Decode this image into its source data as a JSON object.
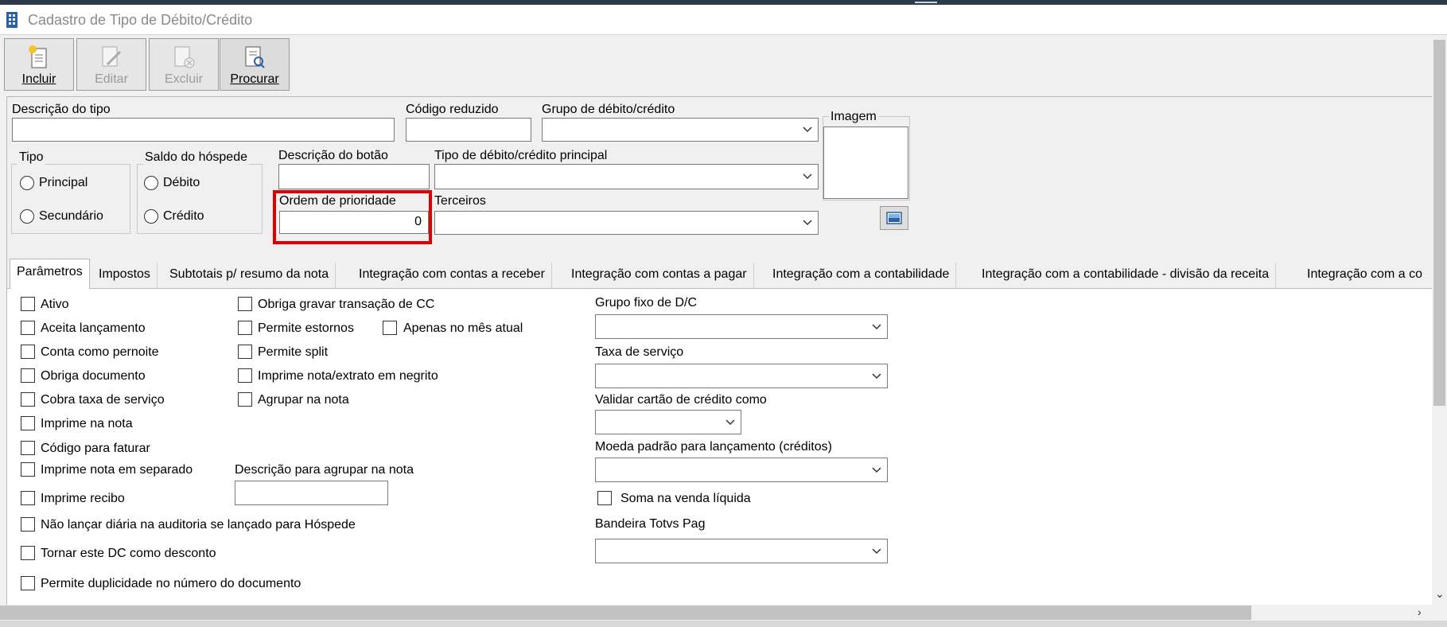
{
  "window": {
    "title": "Cadastro de Tipo de Débito/Crédito"
  },
  "toolbar": {
    "buttons": [
      {
        "id": "incluir",
        "label": "Incluir",
        "enabled": true
      },
      {
        "id": "editar",
        "label": "Editar",
        "enabled": false
      },
      {
        "id": "excluir",
        "label": "Excluir",
        "enabled": false
      },
      {
        "id": "procurar",
        "label": "Procurar",
        "enabled": true
      }
    ]
  },
  "form": {
    "descricao_tipo": {
      "label": "Descrição do tipo",
      "value": ""
    },
    "codigo_reduzido": {
      "label": "Código reduzido",
      "value": ""
    },
    "grupo_debito_credito": {
      "label": "Grupo de débito/crédito",
      "value": ""
    },
    "imagem": {
      "label": "Imagem"
    },
    "tipo": {
      "label": "Tipo",
      "options": [
        "Principal",
        "Secundário"
      ],
      "selected": null
    },
    "saldo_hospede": {
      "label": "Saldo do hóspede",
      "options": [
        "Débito",
        "Crédito"
      ],
      "selected": null
    },
    "descricao_botao": {
      "label": "Descrição do botão",
      "value": ""
    },
    "tipo_principal": {
      "label": "Tipo de débito/crédito principal",
      "value": ""
    },
    "ordem_prioridade": {
      "label": "Ordem de prioridade",
      "value": "0"
    },
    "terceiros": {
      "label": "Terceiros",
      "value": ""
    }
  },
  "tabs": [
    {
      "label": "Parâmetros",
      "active": true
    },
    {
      "label": "Impostos"
    },
    {
      "label": "Subtotais p/ resumo da nota"
    },
    {
      "label": "Integração com contas a receber"
    },
    {
      "label": "Integração com contas a pagar"
    },
    {
      "label": "Integração com a contabilidade"
    },
    {
      "label": "Integração com a contabilidade - divisão da receita"
    },
    {
      "label": "Integração com a co"
    }
  ],
  "parametros": {
    "col1": [
      {
        "label": "Ativo",
        "checked": false
      },
      {
        "label": "Aceita lançamento",
        "checked": false
      },
      {
        "label": "Conta como pernoite",
        "checked": false
      },
      {
        "label": "Obriga documento",
        "checked": false
      },
      {
        "label": "Cobra taxa de serviço",
        "checked": false
      },
      {
        "label": "Imprime na nota",
        "checked": false
      },
      {
        "label": "Código para faturar",
        "checked": false
      },
      {
        "label": "Imprime nota em separado",
        "checked": false
      },
      {
        "label": "Imprime recibo",
        "checked": false
      },
      {
        "label": "Não lançar diária na auditoria se lançado para Hóspede",
        "checked": false
      },
      {
        "label": "Tornar este DC como desconto",
        "checked": false
      },
      {
        "label": "Permite duplicidade no número do documento",
        "checked": false
      }
    ],
    "col2": [
      {
        "label": "Obriga gravar transação de CC",
        "checked": false
      },
      {
        "label": "Permite estornos",
        "checked": false
      },
      {
        "label": "Permite split",
        "checked": false
      },
      {
        "label": "Imprime nota/extrato em negrito",
        "checked": false
      },
      {
        "label": "Agrupar na nota",
        "checked": false
      }
    ],
    "apenas_mes_atual": {
      "label": "Apenas no mês atual",
      "checked": false
    },
    "descricao_agrupar": {
      "label": "Descrição para agrupar na nota",
      "value": ""
    },
    "grupo_fixo": {
      "label": "Grupo fixo de D/C",
      "value": ""
    },
    "taxa_servico": {
      "label": "Taxa de serviço",
      "value": ""
    },
    "validar_cartao": {
      "label": "Validar cartão de crédito como",
      "value": ""
    },
    "moeda_padrao": {
      "label": "Moeda padrão para lançamento (créditos)",
      "value": ""
    },
    "soma_venda_liquida": {
      "label": "Soma na venda líquida",
      "checked": false
    },
    "bandeira_totvs": {
      "label": "Bandeira Totvs Pag",
      "value": ""
    }
  },
  "colors": {
    "highlight": "#e00000",
    "panel": "#ffffff",
    "background": "#f0f0f0"
  }
}
